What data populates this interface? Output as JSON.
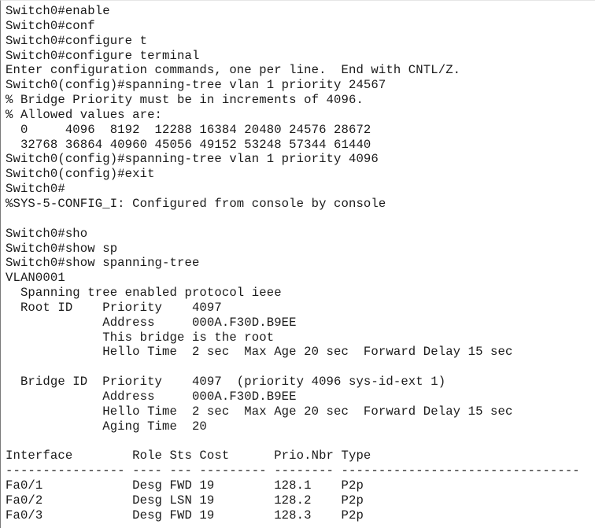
{
  "terminal": {
    "lines": [
      "Switch0#enable",
      "Switch0#conf",
      "Switch0#configure t",
      "Switch0#configure terminal",
      "Enter configuration commands, one per line.  End with CNTL/Z.",
      "Switch0(config)#spanning-tree vlan 1 priority 24567",
      "% Bridge Priority must be in increments of 4096.",
      "% Allowed values are:",
      "  0     4096  8192  12288 16384 20480 24576 28672",
      "  32768 36864 40960 45056 49152 53248 57344 61440",
      "Switch0(config)#spanning-tree vlan 1 priority 4096",
      "Switch0(config)#exit",
      "Switch0#",
      "%SYS-5-CONFIG_I: Configured from console by console",
      "",
      "Switch0#sho",
      "Switch0#show sp",
      "Switch0#show spanning-tree",
      "VLAN0001",
      "  Spanning tree enabled protocol ieee",
      "  Root ID    Priority    4097",
      "             Address     000A.F30D.B9EE",
      "             This bridge is the root",
      "             Hello Time  2 sec  Max Age 20 sec  Forward Delay 15 sec",
      "",
      "  Bridge ID  Priority    4097  (priority 4096 sys-id-ext 1)",
      "             Address     000A.F30D.B9EE",
      "             Hello Time  2 sec  Max Age 20 sec  Forward Delay 15 sec",
      "             Aging Time  20",
      "",
      "Interface        Role Sts Cost      Prio.Nbr Type",
      "---------------- ---- --- --------- -------- --------------------------------",
      "Fa0/1            Desg FWD 19        128.1    P2p",
      "Fa0/2            Desg LSN 19        128.2    P2p",
      "Fa0/3            Desg FWD 19        128.3    P2p"
    ]
  }
}
